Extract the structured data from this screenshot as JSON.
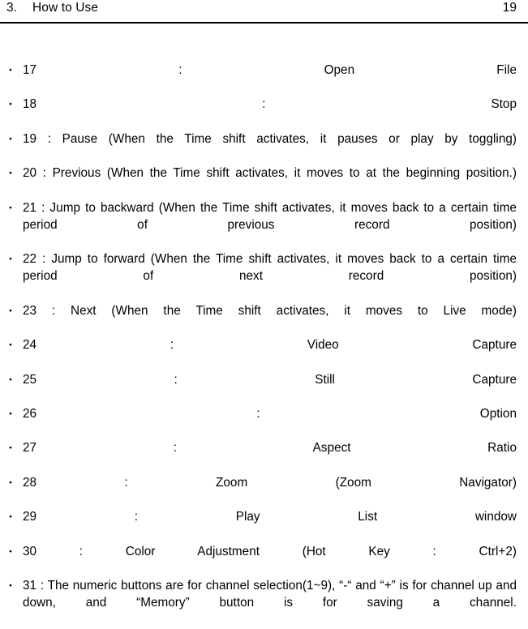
{
  "header": {
    "section_number": "3.",
    "title": "How to Use",
    "page_number": "19",
    "rule_color": "#000000"
  },
  "document": {
    "bullet_glyph": "・",
    "text_color": "#000000",
    "background_color": "#ffffff",
    "items": [
      {
        "id": "17",
        "text": "17 : Open File"
      },
      {
        "id": "18",
        "text": "18 : Stop"
      },
      {
        "id": "19",
        "text": "19 : Pause (When the Time shift activates, it pauses or play by toggling)"
      },
      {
        "id": "20",
        "text": "20 : Previous (When the Time shift activates, it moves to at the beginning position.)"
      },
      {
        "id": "21",
        "text": "21 : Jump to backward (When the Time shift activates, it moves back to a certain time period of previous record position)"
      },
      {
        "id": "22",
        "text": "22 : Jump to forward (When the Time shift activates, it moves back to a certain time period of next record position)"
      },
      {
        "id": "23",
        "text": "23 : Next (When the Time shift activates, it moves to Live mode)"
      },
      {
        "id": "24",
        "text": "24 : Video Capture"
      },
      {
        "id": "25",
        "text": "25 : Still Capture"
      },
      {
        "id": "26",
        "text": "26 : Option"
      },
      {
        "id": "27",
        "text": "27 : Aspect Ratio"
      },
      {
        "id": "28",
        "text": "28 : Zoom (Zoom Navigator)"
      },
      {
        "id": "29",
        "text": "29 : Play List window"
      },
      {
        "id": "30",
        "text": "30 : Color Adjustment (Hot Key : Ctrl+2)"
      },
      {
        "id": "31",
        "text": "31 : The numeric buttons are for channel selection(1~9), “-“ and “+” is for channel up and down, and “Memory” button is for saving a channel."
      }
    ]
  }
}
